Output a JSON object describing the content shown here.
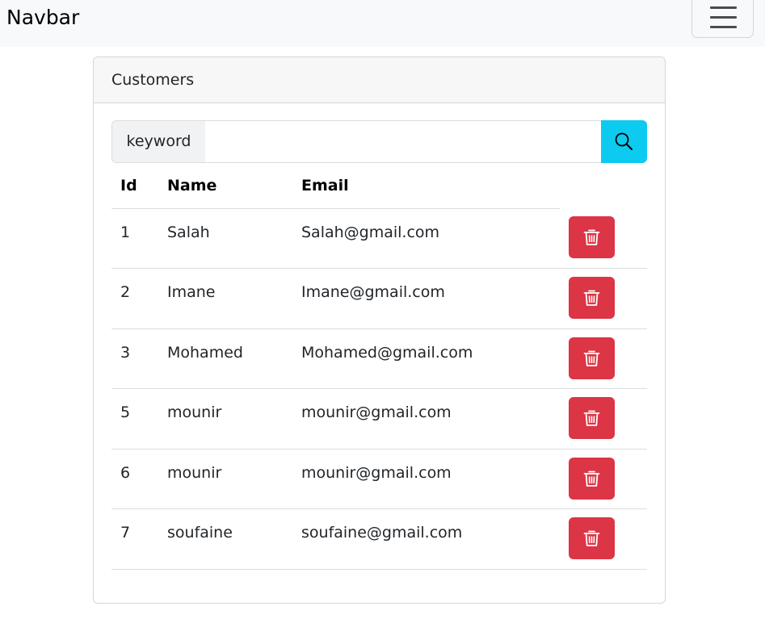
{
  "navbar": {
    "brand": "Navbar",
    "toggler_icon": "hamburger-icon"
  },
  "card": {
    "title": "Customers"
  },
  "search": {
    "label": "keyword",
    "value": "",
    "placeholder": "",
    "button_icon": "search-icon"
  },
  "table": {
    "headers": [
      "Id",
      "Name",
      "Email"
    ],
    "rows": [
      {
        "id": "1",
        "name": "Salah",
        "email": "Salah@gmail.com"
      },
      {
        "id": "2",
        "name": "Imane",
        "email": "Imane@gmail.com"
      },
      {
        "id": "3",
        "name": "Mohamed",
        "email": "Mohamed@gmail.com"
      },
      {
        "id": "5",
        "name": "mounir",
        "email": "mounir@gmail.com"
      },
      {
        "id": "6",
        "name": "mounir",
        "email": "mounir@gmail.com"
      },
      {
        "id": "7",
        "name": "soufaine",
        "email": "soufaine@gmail.com"
      }
    ],
    "row_action_icon": "trash-icon"
  },
  "colors": {
    "navbar_bg": "#f8f9fa",
    "info": "#0dcaf0",
    "danger": "#dc3545"
  }
}
